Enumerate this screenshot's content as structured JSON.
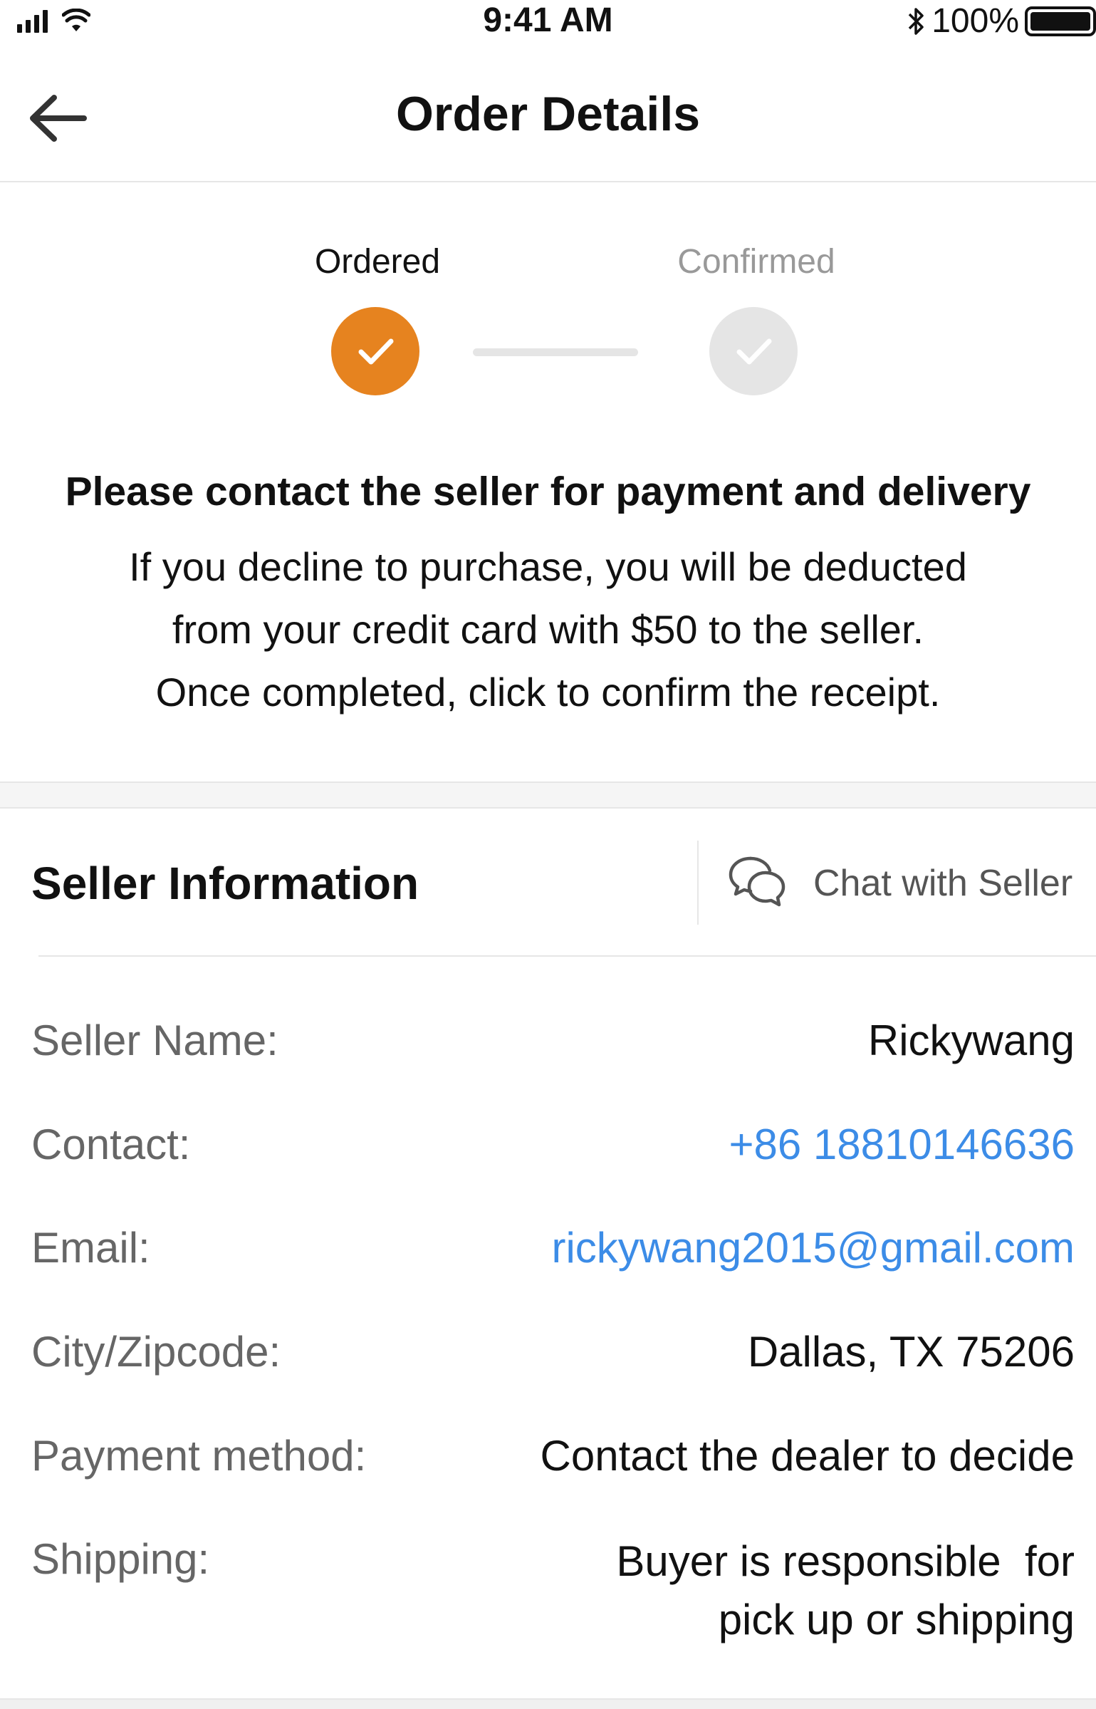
{
  "status_bar": {
    "time": "9:41 AM",
    "battery_percent": "100%",
    "icons": [
      "signal-icon",
      "wifi-icon",
      "bluetooth-icon",
      "battery-icon"
    ]
  },
  "nav": {
    "title": "Order Details",
    "back_icon": "arrow-left-icon"
  },
  "progress": {
    "steps": [
      {
        "label": "Ordered",
        "state": "completed",
        "color": "#e6831f"
      },
      {
        "label": "Confirmed",
        "state": "pending",
        "color": "#e5e5e5"
      }
    ]
  },
  "notice": {
    "title": "Please contact the seller for payment and delivery",
    "lines": [
      "If you decline to purchase, you will be deducted",
      "from your credit card with $50 to the seller.",
      "Once completed, click to confirm the receipt."
    ]
  },
  "seller": {
    "section_title": "Seller Information",
    "chat_label": "Chat with Seller",
    "chat_icon": "chat-bubbles-icon",
    "rows": [
      {
        "label": "Seller Name:",
        "value": "Rickywang"
      },
      {
        "label": "Contact:",
        "value": "+86 18810146636",
        "link": true
      },
      {
        "label": "Email:",
        "value": "rickywang2015@gmail.com",
        "link": true
      },
      {
        "label": "City/Zipcode:",
        "value": "Dallas, TX 75206"
      },
      {
        "label": "Payment method:",
        "value": "Contact the dealer to decide"
      },
      {
        "label": "Shipping:",
        "value_lines": [
          "Buyer is responsible  for",
          "pick up or shipping"
        ]
      }
    ]
  },
  "colors": {
    "accent": "#e6831f",
    "link": "#3c8ce7",
    "muted": "#999999"
  }
}
